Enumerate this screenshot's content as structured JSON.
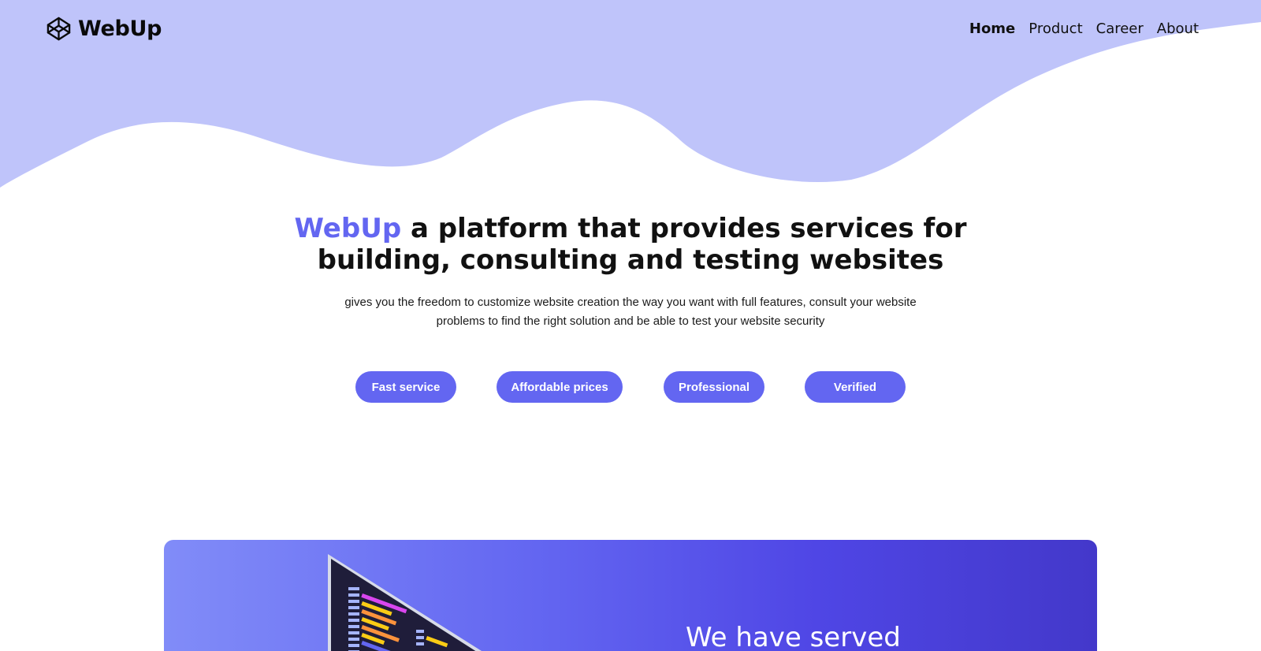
{
  "navbar": {
    "logo_text": "WebUp",
    "logo_icon": "codepen-cube-icon",
    "links": [
      {
        "label": "Home",
        "active": true
      },
      {
        "label": "Product",
        "active": false
      },
      {
        "label": "Career",
        "active": false
      },
      {
        "label": "About",
        "active": false
      }
    ]
  },
  "hero": {
    "brand": "WebUp",
    "title_rest_line1": " a platform that provides services for",
    "title_line2": "building, consulting and testing websites",
    "subtitle": "gives you the freedom to customize website creation the way you want with full features, consult your website problems to find the right solution and be able to test your website security"
  },
  "features": [
    "Fast service",
    "Affordable prices",
    "Professional",
    "Verified"
  ],
  "promo": {
    "heading": "We have served"
  },
  "colors": {
    "accent": "#6366f1",
    "wave": "#bfc4fa",
    "promo_start": "#818cf8",
    "promo_end": "#4338ca"
  }
}
